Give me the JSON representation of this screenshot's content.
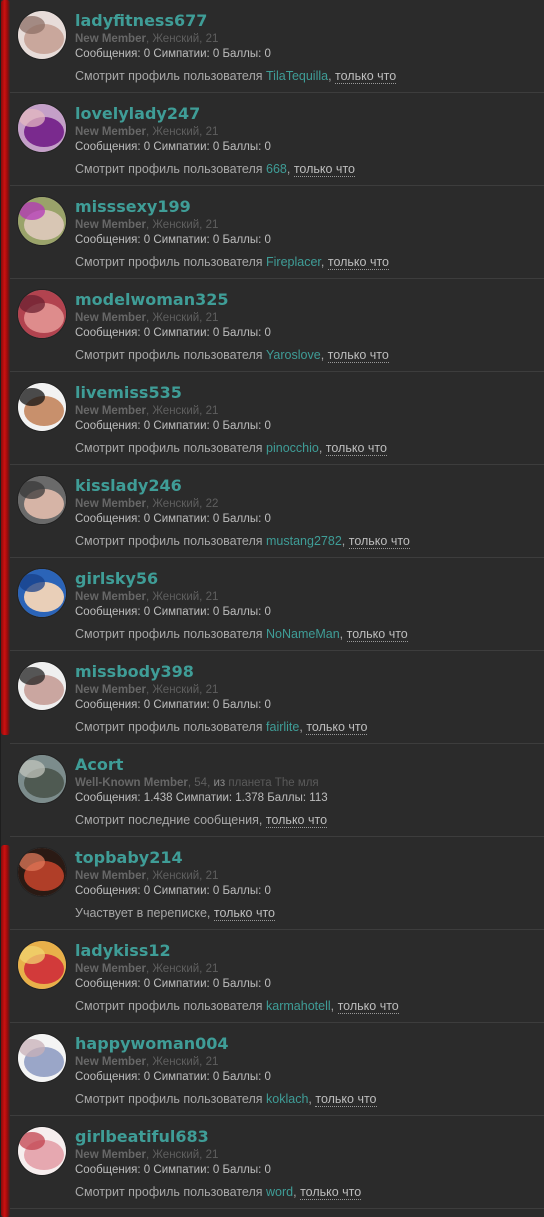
{
  "members": [
    {
      "name": "ladyfitness677",
      "title": "New Member",
      "details": "Женский, 21",
      "stats": "Сообщения: 0 Симпатии: 0 Баллы: 0",
      "action": "Смотрит профиль пользователя",
      "target": "TilaTequilla",
      "time": "только что",
      "avatar": [
        "#e7dcd9",
        "#c9a79c",
        "#8c6f66"
      ]
    },
    {
      "name": "lovelylady247",
      "title": "New Member",
      "details": "Женский, 21",
      "stats": "Сообщения: 0 Симпатии: 0 Баллы: 0",
      "action": "Смотрит профиль пользователя",
      "target": "668",
      "time": "только что",
      "avatar": [
        "#c4a0c8",
        "#7a2a8e",
        "#e4b8c0"
      ]
    },
    {
      "name": "misssexy199",
      "title": "New Member",
      "details": "Женский, 21",
      "stats": "Сообщения: 0 Симпатии: 0 Баллы: 0",
      "action": "Смотрит профиль пользователя",
      "target": "Fireplacer",
      "time": "только что",
      "avatar": [
        "#9aa36a",
        "#d8c6b4",
        "#b335b8"
      ]
    },
    {
      "name": "modelwoman325",
      "title": "New Member",
      "details": "Женский, 21",
      "stats": "Сообщения: 0 Симпатии: 0 Баллы: 0",
      "action": "Смотрит профиль пользователя",
      "target": "Yaroslove",
      "time": "только что",
      "avatar": [
        "#b2434f",
        "#de8c8c",
        "#6b2030"
      ]
    },
    {
      "name": "livemiss535",
      "title": "New Member",
      "details": "Женский, 21",
      "stats": "Сообщения: 0 Симпатии: 0 Баллы: 0",
      "action": "Смотрит профиль пользователя",
      "target": "pinocchio",
      "time": "только что",
      "avatar": [
        "#f2f2f2",
        "#c8906c",
        "#111111"
      ]
    },
    {
      "name": "kisslady246",
      "title": "New Member",
      "details": "Женский, 22",
      "stats": "Сообщения: 0 Симпатии: 0 Баллы: 0",
      "action": "Смотрит профиль пользователя",
      "target": "mustang2782",
      "time": "только что",
      "avatar": [
        "#6a6a6a",
        "#d6b4a6",
        "#3a3a3a"
      ]
    },
    {
      "name": "girlsky56",
      "title": "New Member",
      "details": "Женский, 21",
      "stats": "Сообщения: 0 Симпатии: 0 Баллы: 0",
      "action": "Смотрит профиль пользователя",
      "target": "NoNameMan",
      "time": "только что",
      "avatar": [
        "#2b64b8",
        "#e9cfb8",
        "#18408a"
      ]
    },
    {
      "name": "missbody398",
      "title": "New Member",
      "details": "Женский, 21",
      "stats": "Сообщения: 0 Симпатии: 0 Баллы: 0",
      "action": "Смотрит профиль пользователя",
      "target": "fairlite",
      "time": "только что",
      "avatar": [
        "#efefef",
        "#caa6a0",
        "#222222"
      ]
    },
    {
      "name": "Acort",
      "title": "Well-Known Member",
      "details": "54,",
      "from_label": "из",
      "location": "планета The мля",
      "stats": "Сообщения: 1.438 Симпатии: 1.378 Баллы: 113",
      "action": "Смотрит последние сообщения,",
      "target": "",
      "time": "только что",
      "avatar": [
        "#7c8c8c",
        "#4f5a52",
        "#c0c4bc"
      ]
    },
    {
      "name": "topbaby214",
      "title": "New Member",
      "details": "Женский, 21",
      "stats": "Сообщения: 0 Симпатии: 0 Баллы: 0",
      "action": "Участвует в переписке,",
      "target": "",
      "time": "только что",
      "avatar": [
        "#2a1a14",
        "#b03e28",
        "#e07a5a"
      ]
    },
    {
      "name": "ladykiss12",
      "title": "New Member",
      "details": "Женский, 21",
      "stats": "Сообщения: 0 Симпатии: 0 Баллы: 0",
      "action": "Смотрит профиль пользователя",
      "target": "karmahotell",
      "time": "только что",
      "avatar": [
        "#e8b04a",
        "#d23a3a",
        "#f2d470"
      ]
    },
    {
      "name": "happywoman004",
      "title": "New Member",
      "details": "Женский, 21",
      "stats": "Сообщения: 0 Симпатии: 0 Баллы: 0",
      "action": "Смотрит профиль пользователя",
      "target": "koklach",
      "time": "только что",
      "avatar": [
        "#f4f4f4",
        "#9aa6c8",
        "#c8b0b8"
      ]
    },
    {
      "name": "girlbeatiful683",
      "title": "New Member",
      "details": "Женский, 21",
      "stats": "Сообщения: 0 Симпатии: 0 Баллы: 0",
      "action": "Смотрит профиль пользователя",
      "target": "word",
      "time": "только что",
      "avatar": [
        "#f6eeee",
        "#e6a8b0",
        "#c2414e"
      ]
    }
  ]
}
